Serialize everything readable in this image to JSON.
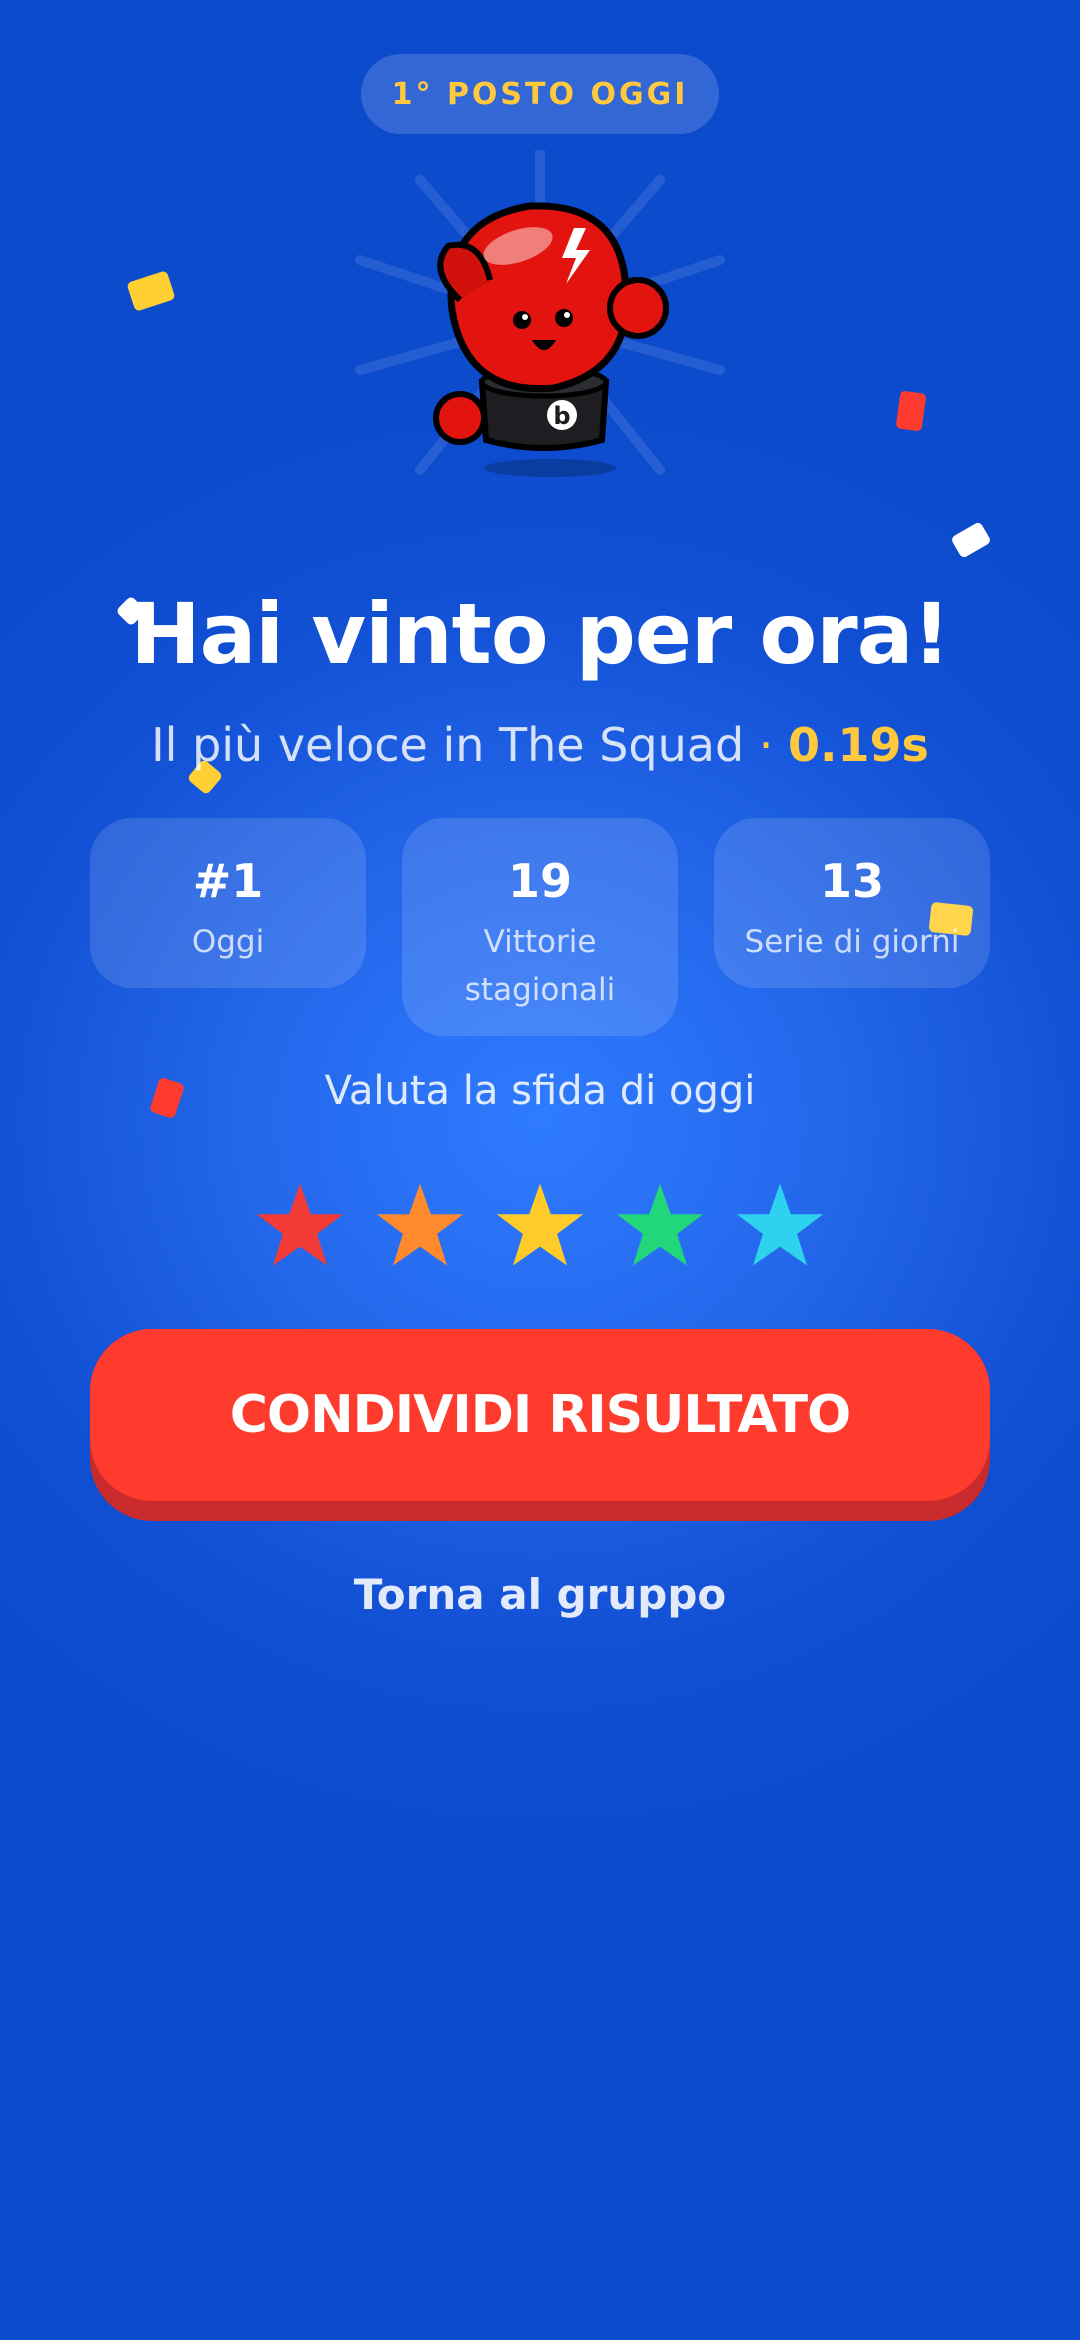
{
  "badge": "1° POSTO OGGI",
  "title": "Hai vinto per ora!",
  "subtitle": {
    "text": "Il più veloce in The Squad",
    "separator": "·",
    "time": "0.19s"
  },
  "stats": [
    {
      "value": "#1",
      "label": "Oggi"
    },
    {
      "value": "19",
      "label": "Vittorie stagionali"
    },
    {
      "value": "13",
      "label": "Serie di giorni"
    }
  ],
  "rating": {
    "label": "Valuta la sfida di oggi",
    "star_colors": [
      "#f23b36",
      "#ff8a2e",
      "#ffcb2b",
      "#22d77a",
      "#2fd2ee"
    ]
  },
  "share_button": "CONDIVIDI RISULTATO",
  "back_link": "Torna al gruppo",
  "mascot": {
    "glove_letter": "b",
    "icon": "boxing-glove-mascot-icon"
  },
  "colors": {
    "accent": "#ffc83d",
    "button": "#ff3b2e",
    "background": "#1452d6"
  }
}
